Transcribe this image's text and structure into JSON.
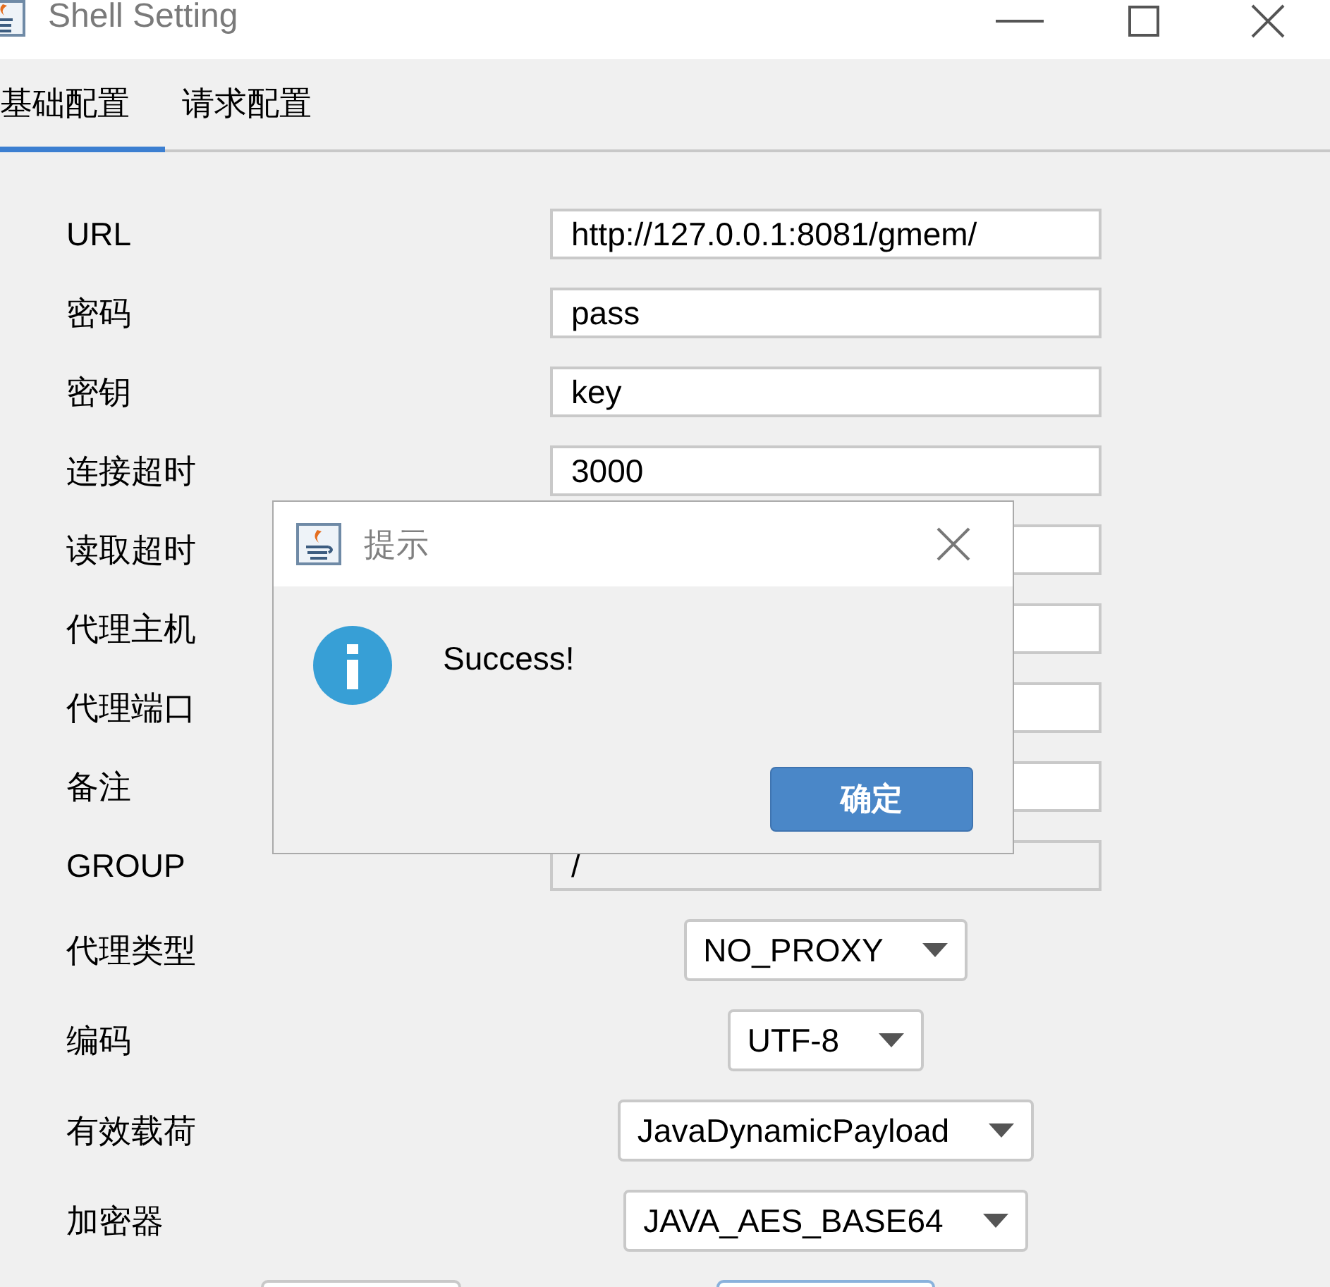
{
  "window": {
    "title": "Shell Setting"
  },
  "tabs": [
    {
      "label": "基础配置",
      "selected": true
    },
    {
      "label": "请求配置",
      "selected": false
    }
  ],
  "fields": [
    {
      "kind": "text",
      "label": "URL",
      "value": "http://127.0.0.1:8081/gmem/",
      "disabled": false
    },
    {
      "kind": "text",
      "label": "密码",
      "value": "pass",
      "disabled": false
    },
    {
      "kind": "text",
      "label": "密钥",
      "value": "key",
      "disabled": false
    },
    {
      "kind": "text",
      "label": "连接超时",
      "value": "3000",
      "disabled": false
    },
    {
      "kind": "text",
      "label": "读取超时",
      "disabled": false
    },
    {
      "kind": "text",
      "label": "代理主机",
      "disabled": false
    },
    {
      "kind": "text",
      "label": "代理端口",
      "disabled": false
    },
    {
      "kind": "text",
      "label": "备注",
      "disabled": false
    },
    {
      "kind": "text",
      "label": "GROUP",
      "value": "/",
      "disabled": true
    },
    {
      "kind": "select",
      "label": "代理类型",
      "value": "NO_PROXY"
    },
    {
      "kind": "select",
      "label": "编码",
      "value": "UTF-8"
    },
    {
      "kind": "select",
      "label": "有效载荷",
      "value": "JavaDynamicPayload"
    },
    {
      "kind": "select",
      "label": "加密器",
      "value": "JAVA_AES_BASE64"
    }
  ],
  "bottom_buttons": [
    {
      "selected": false
    },
    {
      "selected": true
    }
  ],
  "dialog": {
    "title": "提示",
    "message": "Success!",
    "button": "确定"
  }
}
